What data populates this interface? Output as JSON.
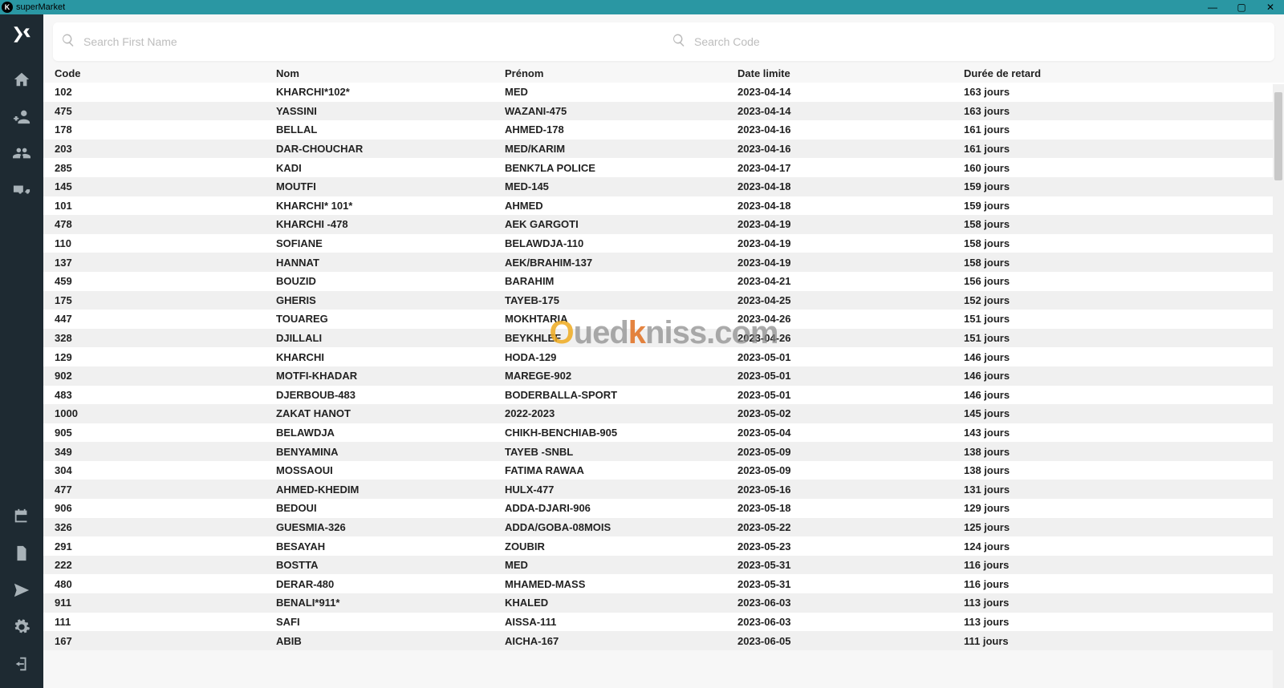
{
  "window": {
    "title": "superMarket"
  },
  "search": {
    "placeholder_name": "Search First Name",
    "placeholder_code": "Search Code"
  },
  "headers": {
    "code": "Code",
    "nom": "Nom",
    "prenom": "Prénom",
    "date": "Date limite",
    "retard": "Durée de retard"
  },
  "watermark": {
    "p1": "O",
    "p2": "ued",
    "p3": "k",
    "p4": "niss.com"
  },
  "rows": [
    {
      "code": "102",
      "nom": "KHARCHI*102*",
      "prenom": "MED",
      "date": "2023-04-14",
      "retard": "163 jours"
    },
    {
      "code": "475",
      "nom": "YASSINI",
      "prenom": "WAZANI-475",
      "date": "2023-04-14",
      "retard": "163 jours"
    },
    {
      "code": "178",
      "nom": "BELLAL",
      "prenom": "AHMED-178",
      "date": "2023-04-16",
      "retard": "161 jours"
    },
    {
      "code": "203",
      "nom": "DAR-CHOUCHAR",
      "prenom": "MED/KARIM",
      "date": "2023-04-16",
      "retard": "161 jours"
    },
    {
      "code": "285",
      "nom": "KADI",
      "prenom": "BENK7LA POLICE",
      "date": "2023-04-17",
      "retard": "160 jours"
    },
    {
      "code": "145",
      "nom": "MOUTFI",
      "prenom": "MED-145",
      "date": "2023-04-18",
      "retard": "159 jours"
    },
    {
      "code": "101",
      "nom": "KHARCHI* 101*",
      "prenom": "AHMED",
      "date": "2023-04-18",
      "retard": "159 jours"
    },
    {
      "code": "478",
      "nom": "KHARCHI -478",
      "prenom": "AEK GARGOTI",
      "date": "2023-04-19",
      "retard": "158 jours"
    },
    {
      "code": "110",
      "nom": "SOFIANE",
      "prenom": "BELAWDJA-110",
      "date": "2023-04-19",
      "retard": "158 jours"
    },
    {
      "code": "137",
      "nom": "HANNAT",
      "prenom": "AEK/BRAHIM-137",
      "date": "2023-04-19",
      "retard": "158 jours"
    },
    {
      "code": "459",
      "nom": "BOUZID",
      "prenom": "BARAHIM",
      "date": "2023-04-21",
      "retard": "156 jours"
    },
    {
      "code": "175",
      "nom": "GHERIS",
      "prenom": "TAYEB-175",
      "date": "2023-04-25",
      "retard": "152 jours"
    },
    {
      "code": "447",
      "nom": "TOUAREG",
      "prenom": "MOKHTARIA",
      "date": "2023-04-26",
      "retard": "151 jours"
    },
    {
      "code": "328",
      "nom": "DJILLALI",
      "prenom": "BEYKHLEF",
      "date": "2023-04-26",
      "retard": "151 jours"
    },
    {
      "code": "129",
      "nom": "KHARCHI",
      "prenom": "HODA-129",
      "date": "2023-05-01",
      "retard": "146 jours"
    },
    {
      "code": "902",
      "nom": "MOTFI-KHADAR",
      "prenom": "MAREGE-902",
      "date": "2023-05-01",
      "retard": "146 jours"
    },
    {
      "code": "483",
      "nom": "DJERBOUB-483",
      "prenom": "BODERBALLA-SPORT",
      "date": "2023-05-01",
      "retard": "146 jours"
    },
    {
      "code": "1000",
      "nom": "ZAKAT HANOT",
      "prenom": "2022-2023",
      "date": "2023-05-02",
      "retard": "145 jours"
    },
    {
      "code": "905",
      "nom": "BELAWDJA",
      "prenom": "CHIKH-BENCHIAB-905",
      "date": "2023-05-04",
      "retard": "143 jours"
    },
    {
      "code": "349",
      "nom": "BENYAMINA",
      "prenom": "TAYEB -SNBL",
      "date": "2023-05-09",
      "retard": "138 jours"
    },
    {
      "code": "304",
      "nom": "MOSSAOUI",
      "prenom": "FATIMA RAWAA",
      "date": "2023-05-09",
      "retard": "138 jours"
    },
    {
      "code": "477",
      "nom": "AHMED-KHEDIM",
      "prenom": "HULX-477",
      "date": "2023-05-16",
      "retard": "131 jours"
    },
    {
      "code": "906",
      "nom": "BEDOUI",
      "prenom": "ADDA-DJARI-906",
      "date": "2023-05-18",
      "retard": "129 jours"
    },
    {
      "code": "326",
      "nom": "GUESMIA-326",
      "prenom": "ADDA/GOBA-08MOIS",
      "date": "2023-05-22",
      "retard": "125 jours"
    },
    {
      "code": "291",
      "nom": "BESAYAH",
      "prenom": "ZOUBIR",
      "date": "2023-05-23",
      "retard": "124 jours"
    },
    {
      "code": "222",
      "nom": "BOSTTA",
      "prenom": "MED",
      "date": "2023-05-31",
      "retard": "116 jours"
    },
    {
      "code": "480",
      "nom": "DERAR-480",
      "prenom": "MHAMED-MASS",
      "date": "2023-05-31",
      "retard": "116 jours"
    },
    {
      "code": "911",
      "nom": "BENALI*911*",
      "prenom": "KHALED",
      "date": "2023-06-03",
      "retard": "113 jours"
    },
    {
      "code": "111",
      "nom": "SAFI",
      "prenom": "AISSA-111",
      "date": "2023-06-03",
      "retard": "113 jours"
    },
    {
      "code": "167",
      "nom": "ABIB",
      "prenom": "AICHA-167",
      "date": "2023-06-05",
      "retard": "111 jours"
    }
  ]
}
